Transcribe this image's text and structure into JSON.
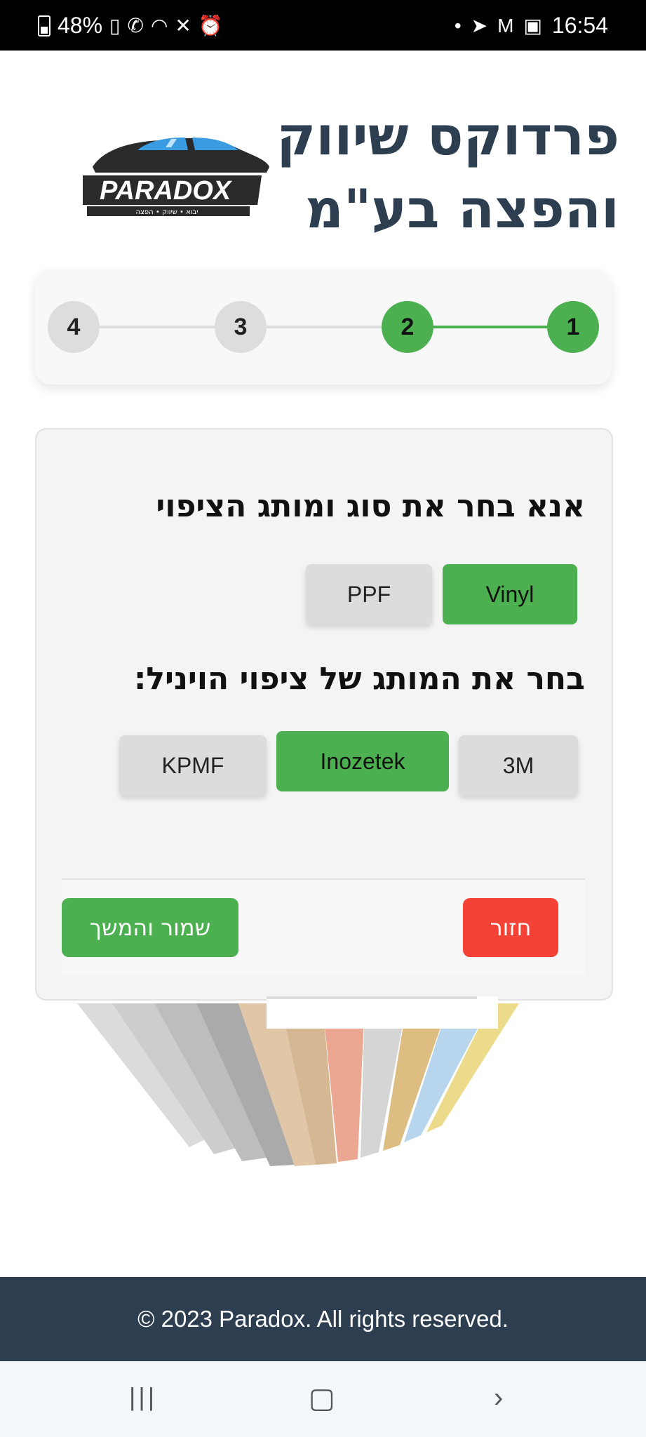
{
  "status_bar": {
    "battery": "48%",
    "time": "16:54",
    "dot": "•"
  },
  "header": {
    "title": "פרדוקס שיווק והפצה בע\"מ",
    "logo_text": "PARADOX",
    "logo_tagline": "יבוא • שיווק • הפצה"
  },
  "stepper": {
    "steps": [
      "1",
      "2",
      "3",
      "4"
    ],
    "current_step": 2,
    "colors": {
      "done": "#4caf50",
      "pending": "#dddddd"
    }
  },
  "form": {
    "question_type": "אנא בחר את סוג ומותג הציפוי",
    "type_options": [
      "Vinyl",
      "PPF"
    ],
    "type_selected": "Vinyl",
    "question_brand": "בחר את המותג של ציפוי הויניל:",
    "brand_options": [
      "3M",
      "Inozetek",
      "KPMF"
    ],
    "brand_selected": "Inozetek",
    "save_button": "שמור והמשך",
    "back_button": "חזור"
  },
  "footer": {
    "copyright": "© 2023 Paradox. All rights reserved."
  },
  "colors": {
    "accent": "#4caf50",
    "danger": "#f44336",
    "dark": "#2c3e50"
  }
}
